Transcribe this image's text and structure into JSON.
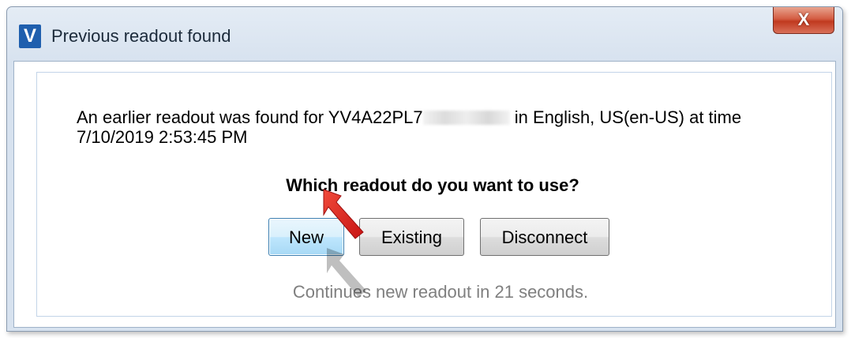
{
  "window": {
    "title": "Previous readout found",
    "app_icon_letter": "V",
    "close_label": "X"
  },
  "dialog": {
    "message_prefix": "An earlier readout was found for YV4A22PL7",
    "message_suffix": " in English, US(en-US) at time",
    "message_line2": "7/10/2019 2:53:45 PM",
    "question": "Which readout do you want to use?",
    "buttons": {
      "new": "New",
      "existing": "Existing",
      "disconnect": "Disconnect"
    },
    "countdown": "Continues new readout in 21 seconds."
  },
  "colors": {
    "app_icon": "#1f5fae",
    "close_button": "#c0391f",
    "annotation_arrow": "#e0211f"
  },
  "icons": [
    "app-logo-icon",
    "close-icon",
    "annotation-arrow-icon"
  ]
}
